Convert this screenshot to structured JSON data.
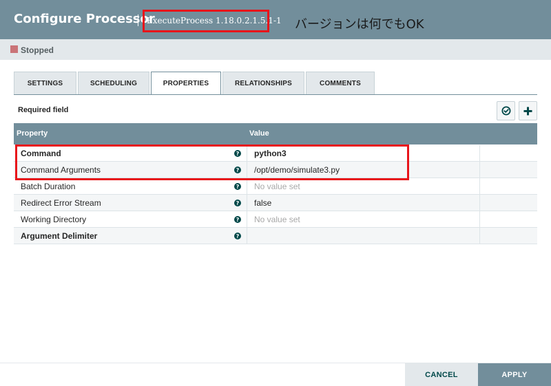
{
  "header": {
    "title": "Configure Processor",
    "subtitle": "ExecuteProcess 1.18.0.2.1.5.1-1",
    "note": "バージョンは何でもOK"
  },
  "status": {
    "label": "Stopped",
    "color": "#ca7478"
  },
  "tabs": [
    {
      "label": "SETTINGS",
      "active": false
    },
    {
      "label": "SCHEDULING",
      "active": false
    },
    {
      "label": "PROPERTIES",
      "active": true
    },
    {
      "label": "RELATIONSHIPS",
      "active": false
    },
    {
      "label": "COMMENTS",
      "active": false
    }
  ],
  "properties": {
    "required_label": "Required field",
    "verify_icon": "check-circle-icon",
    "add_icon": "plus-icon",
    "columns": {
      "property": "Property",
      "value": "Value"
    },
    "rows": [
      {
        "name": "Command",
        "value": "python3",
        "required": true,
        "empty": false
      },
      {
        "name": "Command Arguments",
        "value": "/opt/demo/simulate3.py",
        "required": false,
        "empty": false
      },
      {
        "name": "Batch Duration",
        "value": "No value set",
        "required": false,
        "empty": true
      },
      {
        "name": "Redirect Error Stream",
        "value": "false",
        "required": false,
        "empty": false
      },
      {
        "name": "Working Directory",
        "value": "No value set",
        "required": false,
        "empty": true
      },
      {
        "name": "Argument Delimiter",
        "value": "",
        "required": true,
        "empty": false
      }
    ],
    "help_glyph": "?"
  },
  "footer": {
    "cancel_label": "CANCEL",
    "apply_label": "APPLY"
  },
  "colors": {
    "accent": "#728e9b",
    "highlight": "#e8141a",
    "help_icon": "#004849"
  }
}
